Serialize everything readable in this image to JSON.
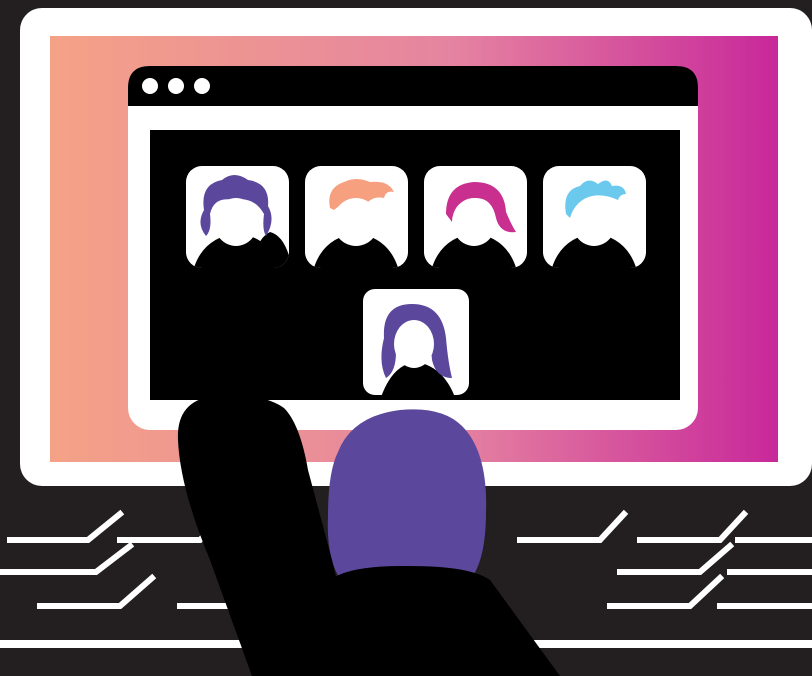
{
  "window": {
    "title": "",
    "controls": [
      "dot",
      "dot",
      "dot"
    ]
  },
  "participants": [
    {
      "name": "",
      "hair_color": "#5b479c",
      "hair_style": "short-curly"
    },
    {
      "name": "",
      "hair_color": "#f6a07f",
      "hair_style": "swept"
    },
    {
      "name": "",
      "hair_color": "#c92f8f",
      "hair_style": "bob"
    },
    {
      "name": "",
      "hair_color": "#6cc9ee",
      "hair_style": "spiky"
    }
  ],
  "self_view": {
    "name": "",
    "hair_color": "#5b479c",
    "hair_style": "long"
  },
  "colors": {
    "frame_dark": "#231f20",
    "bezel": "#ffffff",
    "gradient_start": "#f4a287",
    "gradient_end": "#c8289a",
    "user_hair": "#5b479c",
    "video_bg": "#000000"
  }
}
